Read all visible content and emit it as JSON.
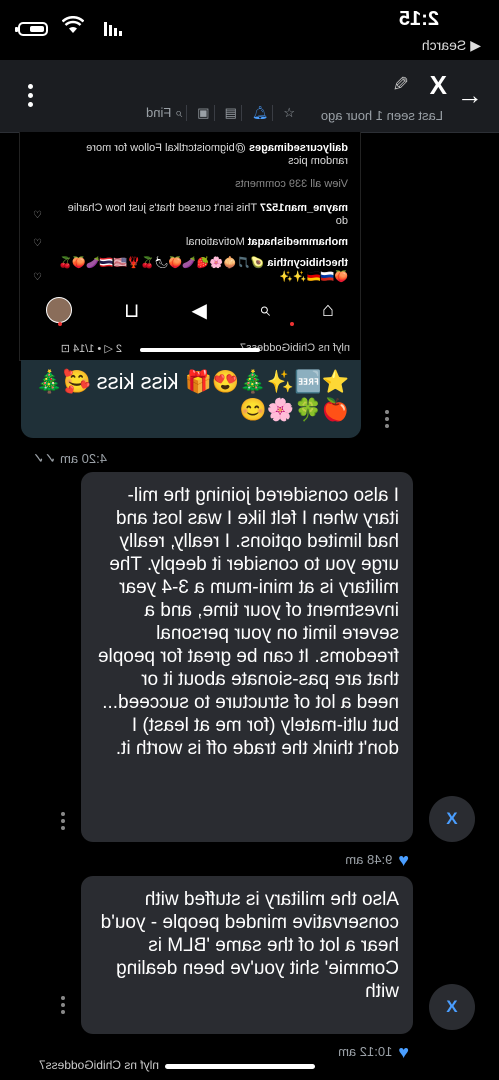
{
  "status_bar": {
    "time": "2:15",
    "back_app": "Search"
  },
  "header": {
    "contact_name": "X",
    "last_seen": "Last seen 1 hour ago",
    "find_label": "Find",
    "icons": [
      "back-arrow-icon",
      "pencil-icon",
      "star-icon",
      "bell-icon",
      "document-icon",
      "image-icon",
      "search-icon",
      "more-icon"
    ]
  },
  "screenshot_card": {
    "comments": [
      {
        "user": "dailycursedimages",
        "text": "@bigmoistcrtlkal Follow for more random pics"
      },
      {
        "text": "View all 339 comments"
      },
      {
        "user": "mayne_man1527",
        "text": "This isn't cursed that's just how Charlie do"
      },
      {
        "user": "mohammedishaqat",
        "text": "Motivational"
      },
      {
        "user": "thechibicynthia",
        "text": "🥑🎵🧅🌸🍓🍆🍑🌶🍒🦞🇺🇸🇹🇭🍆🍑🍒🍑🇷🇺🇩🇪✨✨"
      }
    ],
    "mini_status_left": "nlyf ns ChibiGoddess7",
    "mini_status_right": "2 ◁ • 1/14 ⊡"
  },
  "messages": [
    {
      "id": "kiss",
      "text": "⭐🆓✨🎄😍🎁 kiss kiss 🥰🎄🍎🍀🌸😊",
      "time": "4:20 am"
    },
    {
      "id": "m1",
      "text": "I also considered joining the mil-itary when I felt like I was lost and had limited options. I really, really urge you to consider it deeply. The military is at mini-mum a 3-4 year investment of your time, and a severe limit on your personal freedoms. It can be great for people that are pas-sionate about it or need a lot of structure to succeed... but ulti-mately (for me at least) I don't think the trade off is worth it.",
      "time": "9:48 am",
      "avatar": "X"
    },
    {
      "id": "m2",
      "text": "Also the military is stuffed with conservative minded people - you'd hear a lot of the same 'BLM is Commie' shit you've been dealing with",
      "time": "10:12 am",
      "avatar": "X"
    }
  ],
  "watermark": "nlyf ns ChibiGoddess7",
  "colors": {
    "accent": "#4a9eff",
    "bubble": "#2a2c31",
    "header": "#1b1d21"
  }
}
